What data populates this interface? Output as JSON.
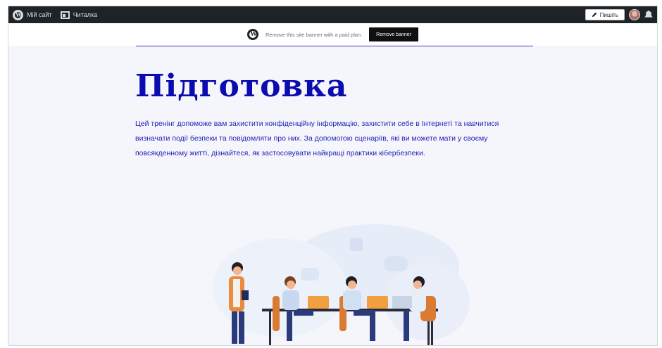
{
  "adminbar": {
    "site_label": "Мій сайт",
    "reader_label": "Читалка",
    "write_label": "Пишіть"
  },
  "banner": {
    "text": "Remove this site banner with a paid plan.",
    "button_label": "Remove banner"
  },
  "page": {
    "title": "Підготовка",
    "description": "Цей тренінг допоможе вам захистити конфіденційну інформацію, захистити себе в Інтернеті та навчитися визначати події безпеки та повідомляти про них. За допомогою сценаріїв, які ви можете мати у своєму повсякденному житті, дізнайтеся, як застосовувати найкращі практики кібербезпеки."
  },
  "icons": {
    "wp": "wordpress-icon",
    "reader": "reader-icon",
    "write": "pencil-icon",
    "avatar": "avatar",
    "notifications": "bell-icon"
  },
  "colors": {
    "adminbar_bg": "#1d2327",
    "accent": "#0b0bb0",
    "text": "#1f1fb6",
    "page_bg": "#f4f6fb"
  }
}
